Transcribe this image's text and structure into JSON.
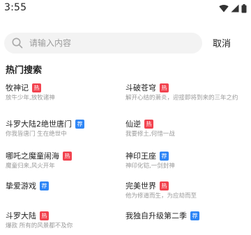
{
  "status_bar": {
    "time": "3:55",
    "icons": [
      "wifi-icon",
      "cellular-signal-icon",
      "battery-icon"
    ]
  },
  "search": {
    "placeholder": "请输入内容",
    "cancel_label": "取消"
  },
  "hot_search": {
    "title": "热门搜索",
    "items": [
      {
        "title": "牧神记",
        "badge": "热",
        "badge_type": "hot",
        "desc": "放牛少年,放牧诸神"
      },
      {
        "title": "斗破苍穹",
        "badge": "热",
        "badge_type": "hot",
        "desc": "解开心结的萧炎，迎接即将到来的三年之约"
      },
      {
        "title": "斗罗大陆2绝世唐门",
        "badge": "荐",
        "badge_type": "rec",
        "desc": "你我皆唐门 生在绝世中"
      },
      {
        "title": "仙逆",
        "badge": "热",
        "badge_type": "hot",
        "desc": "我要修土,何惜一战"
      },
      {
        "title": "哪吒之魔童闹海",
        "badge": "热",
        "badge_type": "hot",
        "desc": "魔童归来,风火开年"
      },
      {
        "title": "神印王座",
        "badge": "荐",
        "badge_type": "rec",
        "desc": "神印化铠,一剑封神"
      },
      {
        "title": "挚爱游戏",
        "badge": "荐",
        "badge_type": "rec",
        "desc": ""
      },
      {
        "title": "完美世界",
        "badge": "热",
        "badge_type": "hot",
        "desc": "他为修道而生，为应劫而至"
      },
      {
        "title": "斗罗大陆",
        "badge": "热",
        "badge_type": "hot",
        "desc": "爆款 所有的风景都不及你"
      },
      {
        "title": "我独自升级第二季",
        "badge": "荐",
        "badge_type": "rec",
        "desc": ""
      }
    ]
  },
  "colors": {
    "hot_badge": "#f2434f",
    "rec_badge": "#2f86f6",
    "search_bg": "#f3f3f3"
  }
}
